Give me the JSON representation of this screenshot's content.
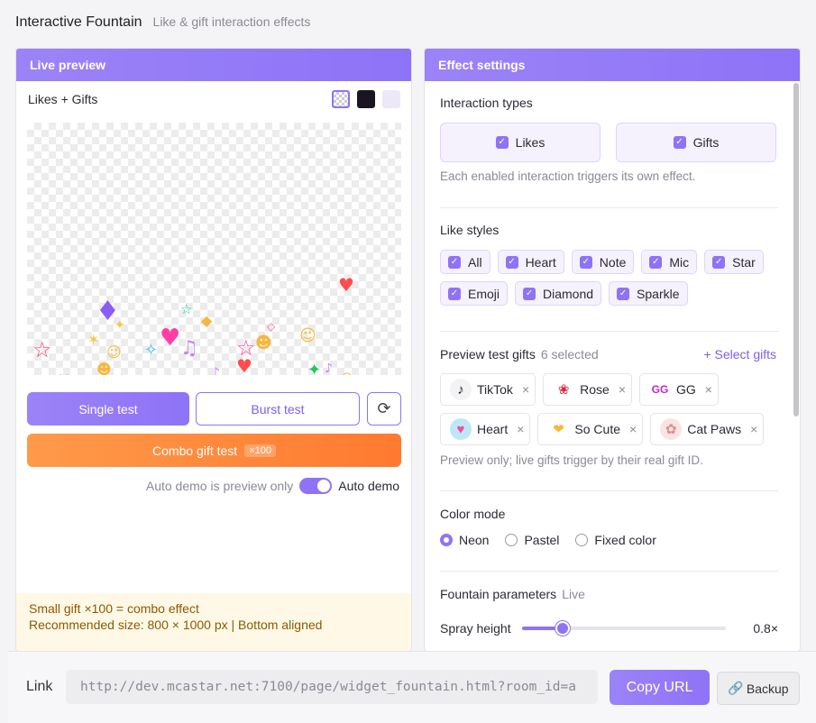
{
  "header": {
    "title": "Interactive Fountain",
    "subtitle": "Like & gift interaction effects"
  },
  "preview": {
    "panel_title": "Live preview",
    "mode_label": "Likes + Gifts",
    "background_options": [
      "checker-bg-icon",
      "dark-bg-icon",
      "light-bg-icon"
    ],
    "buttons": {
      "single": "Single test",
      "burst": "Burst test",
      "reset_icon": "refresh-icon",
      "combo": "Combo gift test",
      "combo_badge": "×100"
    },
    "auto_demo": {
      "hint": "Auto demo is preview only",
      "label": "Auto demo",
      "enabled": true
    },
    "note": {
      "line1": "Small gift ×100 = combo effect",
      "line2": "Recommended size: 800 × 1000 px | Bottom aligned"
    }
  },
  "settings": {
    "panel_title": "Effect settings",
    "interaction_types": {
      "label": "Interaction types",
      "options": [
        {
          "label": "Likes",
          "checked": true
        },
        {
          "label": "Gifts",
          "checked": true
        }
      ],
      "helper": "Each enabled interaction triggers its own effect."
    },
    "like_styles": {
      "label": "Like styles",
      "options": [
        "All",
        "Heart",
        "Note",
        "Mic",
        "Star",
        "Emoji",
        "Diamond",
        "Sparkle"
      ]
    },
    "preview_gifts": {
      "label": "Preview test gifts",
      "count_text": "6 selected",
      "select_link": "+ Select gifts",
      "gifts": [
        {
          "name": "TikTok",
          "icon": "tiktok-icon"
        },
        {
          "name": "Rose",
          "icon": "rose-icon"
        },
        {
          "name": "GG",
          "icon": "gg-icon"
        },
        {
          "name": "Heart",
          "icon": "heart-gift-icon"
        },
        {
          "name": "So Cute",
          "icon": "so-cute-icon"
        },
        {
          "name": "Cat Paws",
          "icon": "cat-paws-icon"
        }
      ],
      "helper": "Preview only; live gifts trigger by their real gift ID."
    },
    "color_mode": {
      "label": "Color mode",
      "options": [
        "Neon",
        "Pastel",
        "Fixed color"
      ],
      "selected": "Neon"
    },
    "fountain": {
      "label": "Fountain parameters",
      "tag": "Live",
      "spray_label": "Spray height",
      "spray_value": "0.8×",
      "spray_fraction": 0.2
    }
  },
  "footer": {
    "link_label": "Link",
    "url": "http://dev.mcastar.net:7100/page/widget_fountain.html?room_id=a",
    "copy": "Copy URL",
    "backup": "Backup"
  },
  "colors": {
    "accent": "#8e73f7",
    "orange": "#ff8a3a",
    "note_bg": "#fff8e6"
  }
}
